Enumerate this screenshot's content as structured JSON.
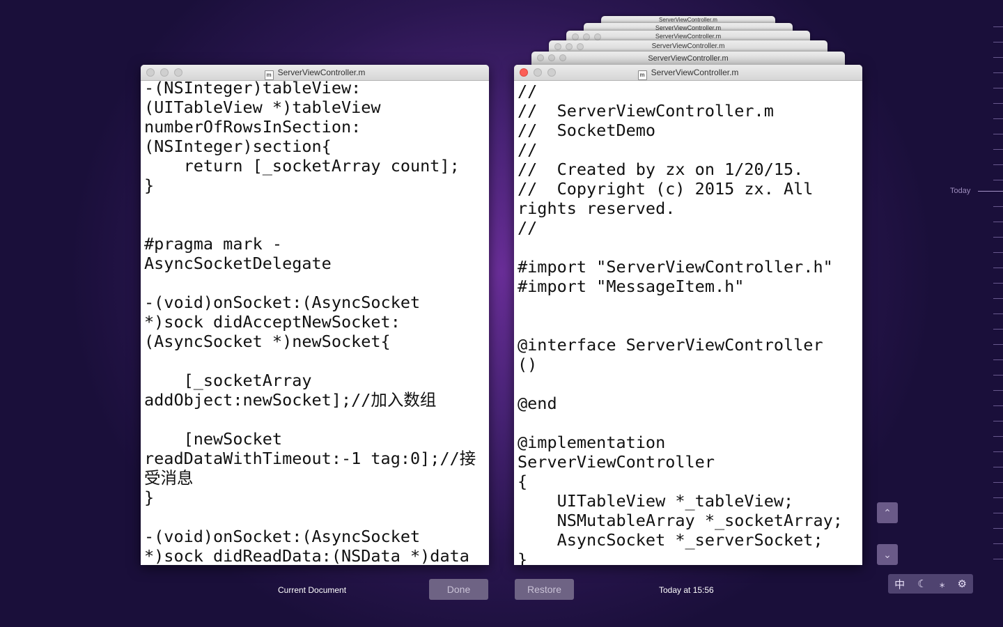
{
  "left_window": {
    "title": "ServerViewController.m",
    "file_icon_letter": "m",
    "code": "-(NSInteger)tableView:\n(UITableView *)tableView\nnumberOfRowsInSection:\n(NSInteger)section{\n    return [_socketArray count];\n}\n\n\n#pragma mark -\nAsyncSocketDelegate\n\n-(void)onSocket:(AsyncSocket\n*)sock didAcceptNewSocket:\n(AsyncSocket *)newSocket{\n\n    [_socketArray\naddObject:newSocket];//加入数组\n\n    [newSocket\nreadDataWithTimeout:-1 tag:0];//接受消息\n}\n\n-(void)onSocket:(AsyncSocket\n*)sock didReadData:(NSData *)data"
  },
  "right_window": {
    "title": "ServerViewController.m",
    "file_icon_letter": "m",
    "code": "//\n//  ServerViewController.m\n//  SocketDemo\n//\n//  Created by zx on 1/20/15.\n//  Copyright (c) 2015 zx. All\nrights reserved.\n//\n\n#import \"ServerViewController.h\"\n#import \"MessageItem.h\"\n\n\n@interface ServerViewController\n()\n\n@end\n\n@implementation\nServerViewController\n{\n    UITableView *_tableView;\n    NSMutableArray *_socketArray;\n    AsyncSocket *_serverSocket;\n}"
  },
  "stacked_versions": [
    {
      "title": "ServerViewController.m"
    },
    {
      "title": "ServerViewController.m"
    },
    {
      "title": "ServerViewController.m"
    },
    {
      "title": "ServerViewController.m"
    },
    {
      "title": "ServerViewController.m"
    }
  ],
  "footer": {
    "current_label": "Current Document",
    "done_label": "Done",
    "restore_label": "Restore",
    "version_time": "Today at 15:56"
  },
  "timeline": {
    "today_label": "Today"
  },
  "controls": {
    "up_glyph": "⌃",
    "down_glyph": "⌄"
  },
  "input_tray": {
    "ime": "中",
    "moon": "☾",
    "sparkle": "⁎",
    "gear": "⚙"
  }
}
